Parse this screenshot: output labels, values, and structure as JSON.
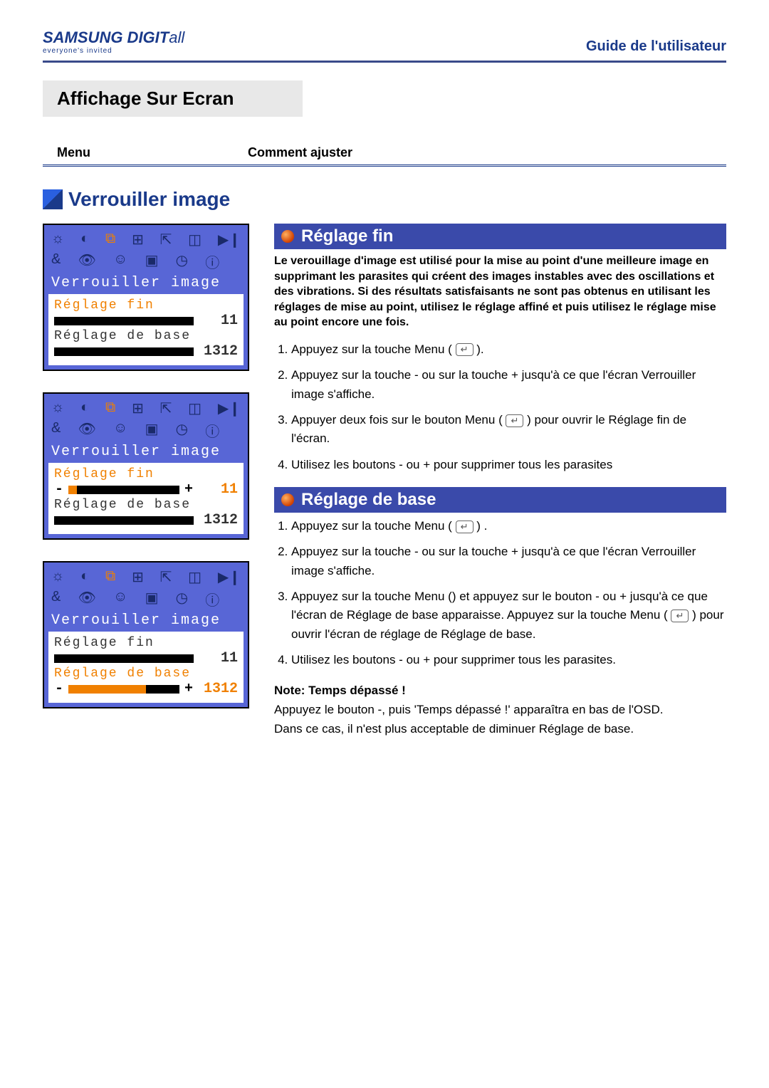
{
  "header": {
    "logo_main": "SAMSUNG DIGIT",
    "logo_script": "all",
    "logo_tag": "everyone's invited",
    "guide": "Guide de l'utilisateur"
  },
  "title": "Affichage Sur Ecran",
  "subheader": {
    "col1": "Menu",
    "col2": "Comment ajuster"
  },
  "section_title": "Verrouiller image",
  "osd": {
    "title": "Verrouiller image",
    "fine_label": "Réglage fin",
    "fine_value": "11",
    "coarse_label": "Réglage de base",
    "coarse_value": "1312"
  },
  "fine": {
    "heading": "Réglage fin",
    "intro": "Le verouillage d'image est utilisé pour la mise au point d'une meilleure image en supprimant les parasites qui créent des images instables avec des oscillations et des vibrations. Si des résultats satisfaisants ne sont pas obtenus en utilisant les réglages de mise au point, utilisez le réglage affiné et puis utilisez le réglage mise au point encore une fois.",
    "steps": [
      "Appuyez sur la touche Menu (",
      "Appuyez sur la touche - ou sur la touche + jusqu'à ce que l'écran Verrouiller image s'affiche.",
      "Appuyer deux fois sur le bouton Menu (",
      "Utilisez les boutons - ou + pour supprimer tous les parasites"
    ],
    "step1_suffix": ").",
    "step3_suffix": ") pour ouvrir le Réglage fin de l'écran."
  },
  "coarse": {
    "heading": "Réglage de base",
    "steps": [
      "Appuyez sur la touche Menu (",
      "Appuyez sur la touche - ou sur la touche + jusqu'à ce que l'écran Verrouiller image s'affiche.",
      "Appuyez sur la touche Menu () et appuyez sur le bouton - ou + jusqu'à ce que l'écran de Réglage de base apparaisse.  Appuyez sur la touche Menu (",
      "Utilisez les boutons - ou + pour supprimer tous les parasites."
    ],
    "step1_suffix": ") .",
    "step3_suffix": ") pour ouvrir  l'écran de réglage de Réglage de base."
  },
  "note": {
    "heading": "Note: Temps dépassé !",
    "body1": "Appuyez le bouton -, puis  'Temps dépassé !' apparaîtra en bas de l'OSD.",
    "body2": "Dans ce cas, il n'est plus acceptable de diminuer Réglage de base."
  }
}
